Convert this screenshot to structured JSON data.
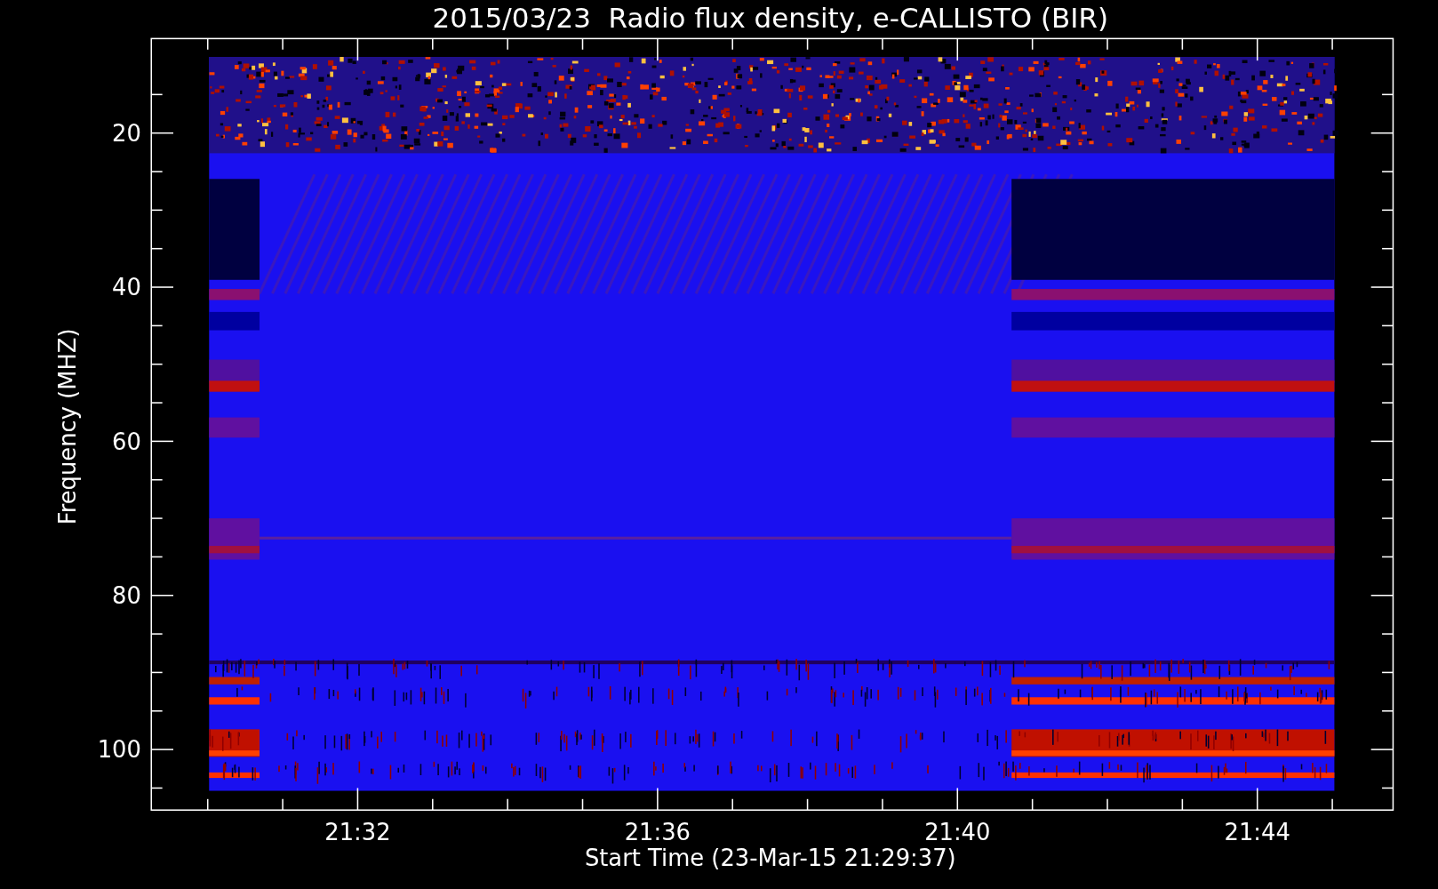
{
  "plot": {
    "title": "2015/03/23  Radio flux density, e-CALLISTO (BIR)",
    "ylabel": "Frequency (MHZ)",
    "xlabel": "Start Time (23-Mar-15 21:29:37)",
    "y_tick_labels": [
      "20",
      "40",
      "60",
      "80",
      "100"
    ],
    "x_tick_labels": [
      "21:32",
      "21:36",
      "21:40",
      "21:44"
    ]
  }
}
